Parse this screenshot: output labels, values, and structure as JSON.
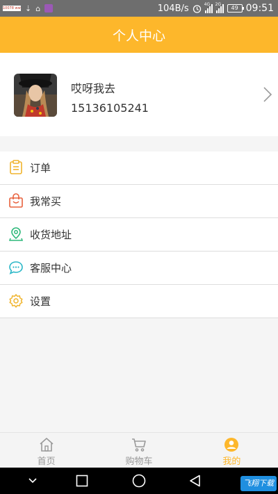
{
  "status_bar": {
    "net_speed": "104B/s",
    "signal_1_label": "4G",
    "signal_2_label": "2G",
    "battery": "49",
    "time": "09:51",
    "ad_text": "10078 www.10078.com"
  },
  "header": {
    "title": "个人中心"
  },
  "profile": {
    "name": "哎呀我去",
    "phone": "15136105241"
  },
  "menu": [
    {
      "label": "订单",
      "icon": "clipboard-icon",
      "color": "#f0b42d"
    },
    {
      "label": "我常买",
      "icon": "shopping-bag-icon",
      "color": "#e8603c"
    },
    {
      "label": "收货地址",
      "icon": "location-pin-icon",
      "color": "#2db87a"
    },
    {
      "label": "客服中心",
      "icon": "chat-bubble-icon",
      "color": "#2ab7c7"
    },
    {
      "label": "设置",
      "icon": "gear-icon",
      "color": "#f0b42d"
    }
  ],
  "tabbar": {
    "items": [
      {
        "label": "首页",
        "icon": "home-icon",
        "active": false
      },
      {
        "label": "购物车",
        "icon": "cart-icon",
        "active": false
      },
      {
        "label": "我的",
        "icon": "user-icon",
        "active": true
      }
    ]
  },
  "navbar": {
    "watermark": "飞翔下载"
  },
  "colors": {
    "accent": "#fdb72b",
    "status_bar": "#6e6e6e",
    "inactive_tab": "#999999"
  }
}
